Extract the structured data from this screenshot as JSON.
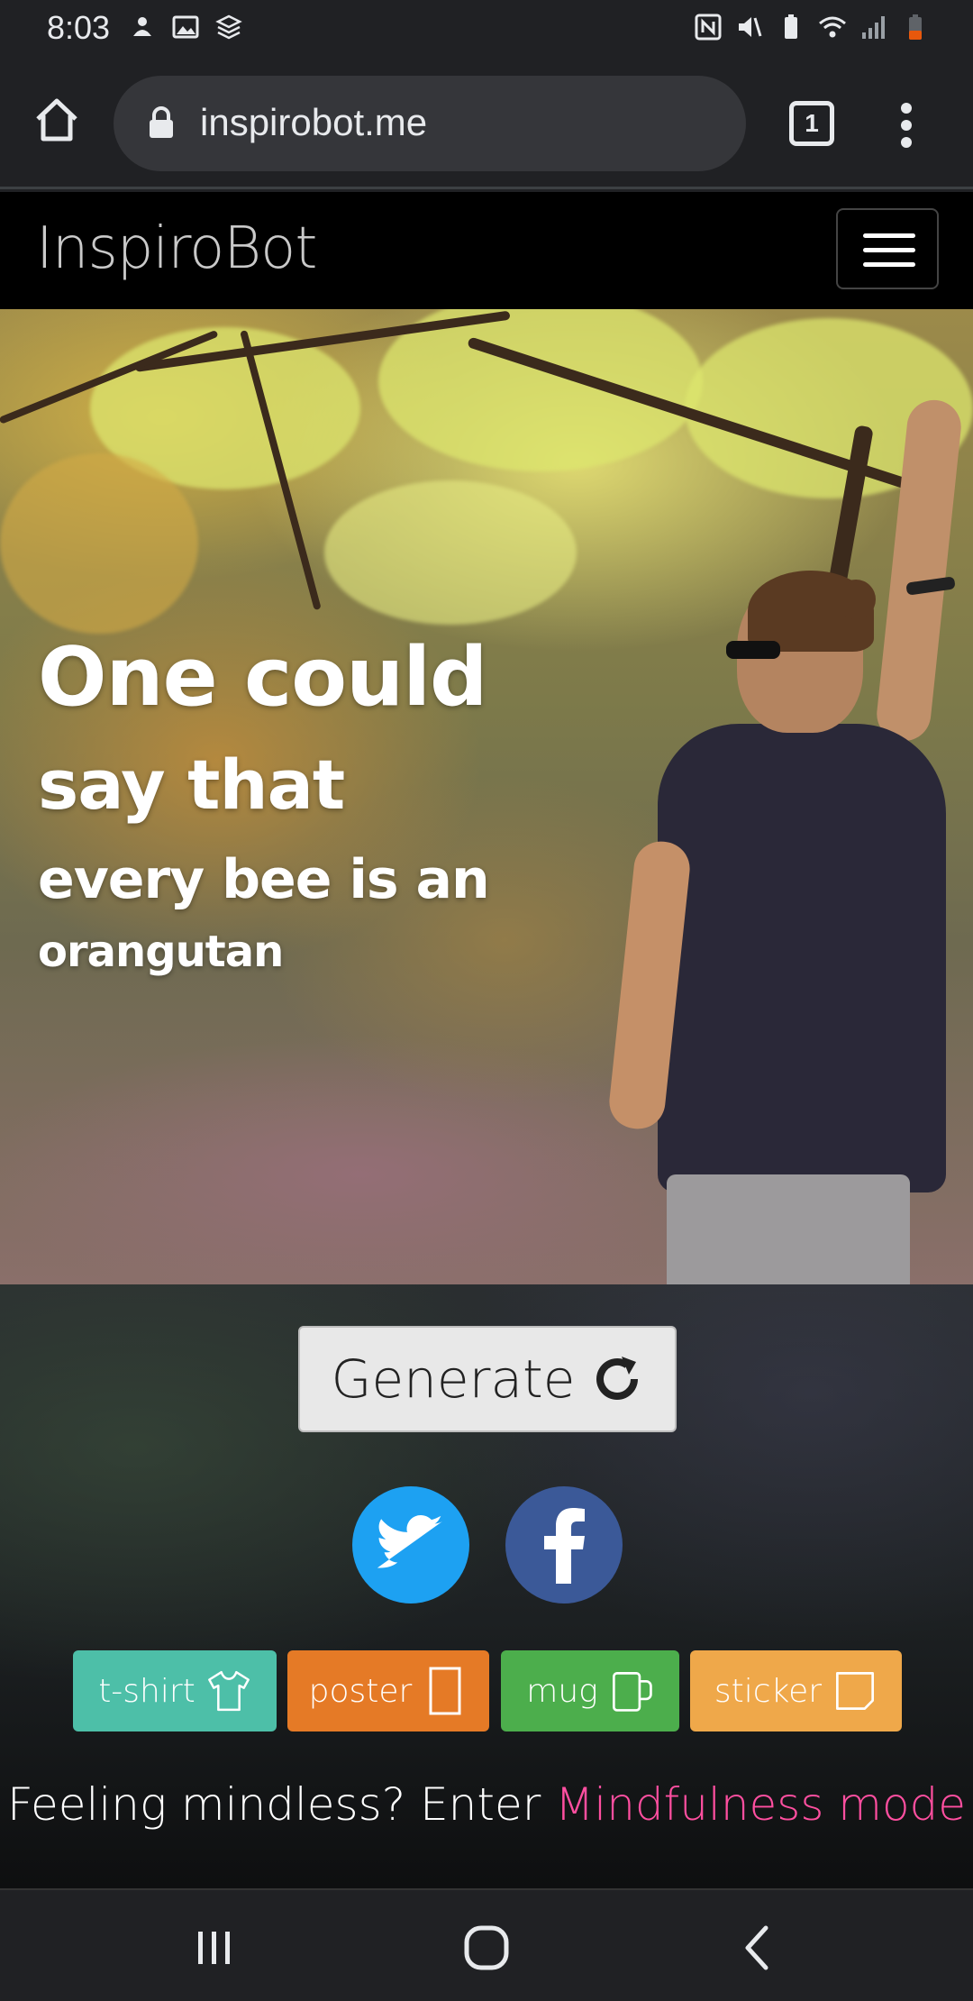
{
  "status_bar": {
    "time": "8:03",
    "left_icons": [
      "notification-icon",
      "gallery-icon",
      "stack-icon"
    ],
    "right_icons": [
      "nfc-icon",
      "mute-icon",
      "battery-saver-icon",
      "wifi-icon",
      "signal-icon",
      "battery-icon"
    ],
    "battery_color": "#e8580c"
  },
  "browser": {
    "url": "inspirobot.me",
    "tab_count": "1"
  },
  "site": {
    "brand": "InspiroBot",
    "quote_lines": [
      "One could",
      "say that",
      "every bee is an",
      "orangutan"
    ],
    "generate_label": "Generate",
    "merch": {
      "tshirt": "t-shirt",
      "poster": "poster",
      "mug": "mug",
      "sticker": "sticker"
    },
    "mindful_prefix": "Feeling mindless? Enter ",
    "mindful_link": "Mindfulness mode",
    "colors": {
      "tshirt": "#4dbfa8",
      "poster": "#e57a26",
      "mug": "#4cae4c",
      "sticker": "#efa84a",
      "twitter": "#1da1f2",
      "facebook": "#3b5998",
      "mindful_link": "#ff4fa0"
    }
  }
}
